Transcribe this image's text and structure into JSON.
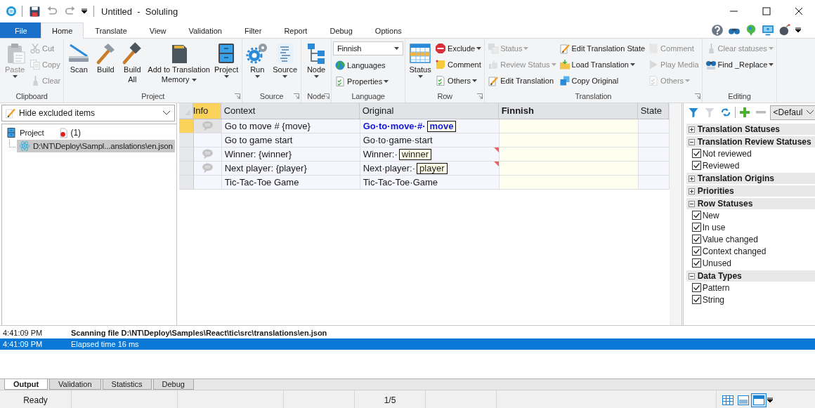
{
  "title_bar": {
    "title": "Untitled  -  Soluling"
  },
  "ribbon": {
    "tabs": [
      {
        "label": "File",
        "kind": "file",
        "selected": false
      },
      {
        "label": "Home",
        "kind": "tab",
        "selected": true
      },
      {
        "label": "Translate",
        "kind": "tab",
        "selected": false
      },
      {
        "label": "View",
        "kind": "tab",
        "selected": false
      },
      {
        "label": "Validation",
        "kind": "tab",
        "selected": false
      },
      {
        "label": "Filter",
        "kind": "tab",
        "selected": false
      },
      {
        "label": "Report",
        "kind": "tab",
        "selected": false
      },
      {
        "label": "Debug",
        "kind": "tab",
        "selected": false
      },
      {
        "label": "Options",
        "kind": "tab",
        "selected": false
      }
    ],
    "groups": [
      {
        "label": "Clipboard",
        "launcher": false,
        "columns": [
          [
            {
              "kind": "large",
              "lines": [
                "Paste"
              ],
              "dropdown": true,
              "disabled": true
            }
          ],
          [
            {
              "kind": "small",
              "label": "Cut",
              "dropdown": false,
              "disabled": true
            },
            {
              "kind": "small",
              "label": "Copy",
              "dropdown": false,
              "disabled": true
            },
            {
              "kind": "small",
              "label": "Clear",
              "dropdown": false,
              "disabled": true
            }
          ]
        ]
      },
      {
        "label": "Project",
        "launcher": true,
        "columns": [
          [
            {
              "kind": "large",
              "lines": [
                "Scan"
              ],
              "dropdown": false,
              "disabled": false
            }
          ],
          [
            {
              "kind": "large",
              "lines": [
                "Build"
              ],
              "dropdown": false,
              "disabled": false
            }
          ],
          [
            {
              "kind": "large",
              "lines": [
                "Build",
                "All"
              ],
              "dropdown": false,
              "disabled": false
            }
          ],
          [
            {
              "kind": "large",
              "lines": [
                "Add to Translation",
                "Memory"
              ],
              "dropdown": true,
              "disabled": false
            }
          ],
          [
            {
              "kind": "large",
              "lines": [
                "Project"
              ],
              "dropdown": true,
              "disabled": false
            }
          ]
        ]
      },
      {
        "label": "Source",
        "launcher": true,
        "columns": [
          [
            {
              "kind": "large",
              "lines": [
                "Run"
              ],
              "dropdown": true,
              "disabled": false
            }
          ],
          [
            {
              "kind": "large",
              "lines": [
                "Source"
              ],
              "dropdown": true,
              "disabled": false
            }
          ]
        ]
      },
      {
        "label": "Node",
        "launcher": true,
        "columns": [
          [
            {
              "kind": "large",
              "lines": [
                "Node"
              ],
              "dropdown": true,
              "disabled": false
            }
          ]
        ]
      },
      {
        "label": "Language",
        "launcher": false,
        "columns": [
          [
            {
              "kind": "combo",
              "value": "Finnish"
            },
            {
              "kind": "small",
              "label": "Languages",
              "dropdown": false,
              "disabled": false
            },
            {
              "kind": "small",
              "label": "Properties",
              "dropdown": true,
              "disabled": false
            }
          ]
        ]
      },
      {
        "label": "Row",
        "launcher": true,
        "columns": [
          [
            {
              "kind": "large",
              "lines": [
                "Status"
              ],
              "dropdown": true,
              "disabled": false
            }
          ],
          [
            {
              "kind": "small",
              "label": "Exclude",
              "dropdown": true,
              "disabled": false
            },
            {
              "kind": "small",
              "label": "Comment",
              "dropdown": false,
              "disabled": false
            },
            {
              "kind": "small",
              "label": "Others",
              "dropdown": true,
              "disabled": false
            }
          ]
        ]
      },
      {
        "label": "Translation",
        "launcher": true,
        "columns": [
          [
            {
              "kind": "small",
              "label": "Status",
              "dropdown": true,
              "disabled": true
            },
            {
              "kind": "small",
              "label": "Review Status",
              "dropdown": true,
              "disabled": true
            },
            {
              "kind": "small",
              "label": "Edit Translation",
              "dropdown": false,
              "disabled": false
            }
          ],
          [
            {
              "kind": "small",
              "label": "Edit Translation State",
              "dropdown": false,
              "disabled": false
            },
            {
              "kind": "small",
              "label": "Load Translation",
              "dropdown": true,
              "disabled": false
            },
            {
              "kind": "small",
              "label": "Copy Original",
              "dropdown": false,
              "disabled": false
            }
          ],
          [
            {
              "kind": "small",
              "label": "Comment",
              "dropdown": false,
              "disabled": true
            },
            {
              "kind": "small",
              "label": "Play Media",
              "dropdown": false,
              "disabled": true
            },
            {
              "kind": "small",
              "label": "Others",
              "dropdown": true,
              "disabled": true
            }
          ]
        ]
      },
      {
        "label": "Editing",
        "launcher": false,
        "columns": [
          [
            {
              "kind": "small",
              "label": "Clear statuses",
              "dropdown": true,
              "disabled": true
            },
            {
              "kind": "small",
              "label": "Find _Replace",
              "dropdown": true,
              "disabled": false
            }
          ]
        ]
      }
    ]
  },
  "left_panel": {
    "filter": {
      "value": "Hide excluded items"
    },
    "tree": [
      {
        "label": "Project",
        "badge": "(1)",
        "selected": false,
        "children": [
          {
            "label": "D:\\NT\\Deploy\\Sampl...anslations\\en.json",
            "selected": true
          }
        ]
      }
    ]
  },
  "grid": {
    "columns": [
      {
        "label": "Info",
        "kind": "info",
        "selected": true
      },
      {
        "label": "Context",
        "kind": "text",
        "selected": false
      },
      {
        "label": "Original",
        "kind": "text",
        "selected": false
      },
      {
        "label": "Finnish",
        "kind": "target",
        "selected": false
      },
      {
        "label": "State",
        "kind": "text",
        "selected": false
      }
    ],
    "rows": [
      {
        "selected": true,
        "comment": true,
        "flagged": false,
        "context": "Go to move # {move}",
        "original": [
          {
            "kind": "text",
            "text": "Go·to·move·#·"
          },
          {
            "kind": "placeholder",
            "text": "move"
          }
        ]
      },
      {
        "selected": false,
        "comment": false,
        "flagged": false,
        "context": "Go to game start",
        "original": [
          {
            "kind": "text",
            "text": "Go·to·game·start"
          }
        ]
      },
      {
        "selected": false,
        "comment": true,
        "flagged": true,
        "context": "Winner: {winner}",
        "original": [
          {
            "kind": "text",
            "text": "Winner:·"
          },
          {
            "kind": "placeholder",
            "text": "winner"
          }
        ]
      },
      {
        "selected": false,
        "comment": true,
        "flagged": true,
        "context": "Next player: {player}",
        "original": [
          {
            "kind": "text",
            "text": "Next·player:·"
          },
          {
            "kind": "placeholder",
            "text": "player"
          }
        ]
      },
      {
        "selected": false,
        "comment": false,
        "flagged": false,
        "context": "Tic-Tac-Toe Game",
        "original": [
          {
            "kind": "text",
            "text": "Tic-Tac-Toe·Game"
          }
        ]
      }
    ]
  },
  "filter_panel": {
    "preset": "<Defaul",
    "sections": [
      {
        "title": "Translation Statuses",
        "expanded": false
      },
      {
        "title": "Translation Review Statuses",
        "expanded": true,
        "items": [
          {
            "label": "Not reviewed",
            "checked": true
          },
          {
            "label": "Reviewed",
            "checked": true
          }
        ]
      },
      {
        "title": "Translation Origins",
        "expanded": false
      },
      {
        "title": "Priorities",
        "expanded": false
      },
      {
        "title": "Row Statuses",
        "expanded": true,
        "items": [
          {
            "label": "New",
            "checked": true
          },
          {
            "label": "In use",
            "checked": true
          },
          {
            "label": "Value changed",
            "checked": true
          },
          {
            "label": "Context changed",
            "checked": true
          },
          {
            "label": "Unused",
            "checked": true
          }
        ]
      },
      {
        "title": "Data Types",
        "expanded": true,
        "items": [
          {
            "label": "Pattern",
            "checked": true
          },
          {
            "label": "String",
            "checked": true
          }
        ]
      }
    ]
  },
  "output": {
    "log": [
      {
        "time": "4:41:09 PM",
        "message": "Scanning file D:\\NT\\Deploy\\Samples\\React\\tic\\src\\translations\\en.json",
        "bold": true,
        "selected": false
      },
      {
        "time": "4:41:09 PM",
        "message": "Elapsed time 16 ms",
        "bold": false,
        "selected": true
      }
    ],
    "tabs": [
      {
        "label": "Output",
        "selected": true
      },
      {
        "label": "Validation",
        "selected": false
      },
      {
        "label": "Statistics",
        "selected": false
      },
      {
        "label": "Debug",
        "selected": false
      }
    ]
  },
  "status_bar": {
    "state": "Ready",
    "position": "1/5",
    "views": [
      {
        "selected": false
      },
      {
        "selected": false
      },
      {
        "selected": true
      }
    ]
  }
}
